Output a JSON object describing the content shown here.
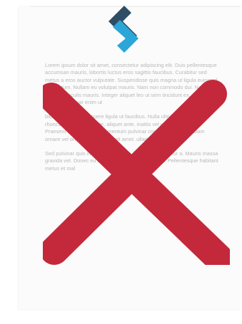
{
  "logo": {
    "icon": "s-logo-icon",
    "colors": {
      "dark": "#2f4d63",
      "light": "#2aa6d8"
    }
  },
  "document": {
    "paragraphs": [
      "Lorem ipsum dolor sit amet, consectetur adipiscing elit. Duis pellentesque accumsan mauris, lobortis luctus eros sagittis faucibus. Curabitur sed metus a eros auctor vulputate. Suspendisse quis magna ut ligula euismod fermentum. Nullam eu volutpat mauris. Nam non commodo dui. Nam vel convallis iaculis mauris. Integer aliquet leo ut sem tincidunt ex. Curabitur pulvinar pulvinar enim ut",
      "bibendum. Nunc posuere ligula ut faucibus. Nulla ultrices nec. Nam rhoncus massa vulputate, aliquet ante, mattis vel ultrices sit amet. Praesent libero sapien, elementum pulvinar consectetur enim. Etiam ornare vel ornare est dapibus sit amet. ullamcorper lacinia.",
      "Sed pulvinar quis integer turpis dolor, feugiat consectetur a. Mauris massa gravida vel. Donec eu sapien quam tempus ultrices. Pellentesque habitant metus et mal"
    ]
  },
  "overlay": {
    "icon": "cross-icon",
    "color": "#c4293b"
  }
}
